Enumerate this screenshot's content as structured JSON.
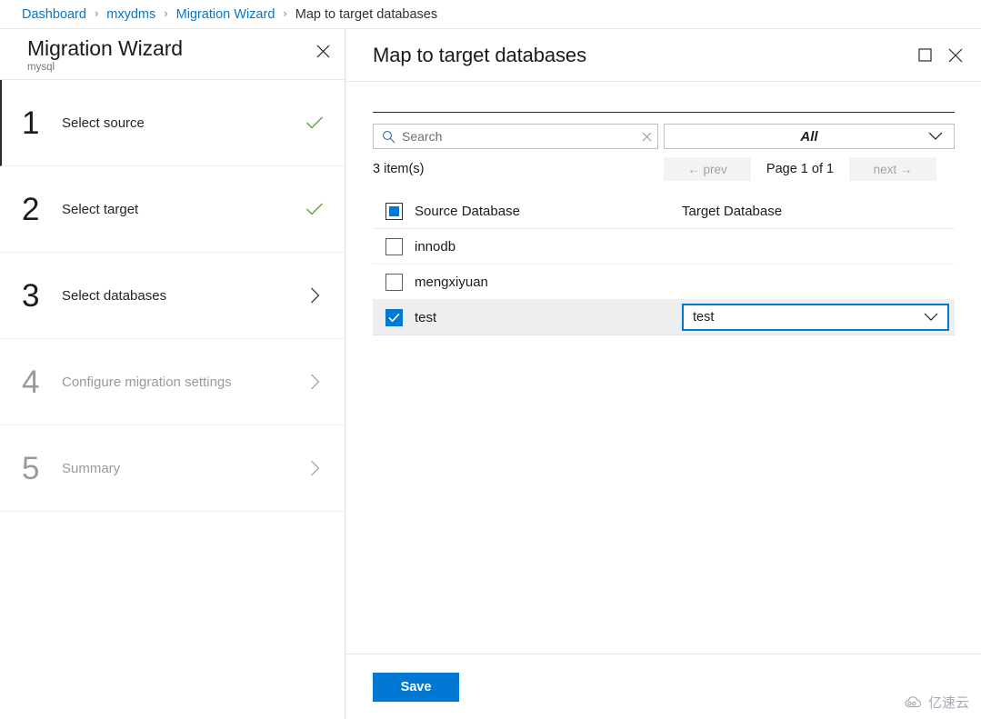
{
  "breadcrumb": {
    "items": [
      {
        "label": "Dashboard",
        "current": false
      },
      {
        "label": "mxydms",
        "current": false
      },
      {
        "label": "Migration Wizard",
        "current": false
      },
      {
        "label": "Map to target databases",
        "current": true
      }
    ],
    "separator": "›",
    "link_color": "#0078d4"
  },
  "wizard": {
    "title": "Migration Wizard",
    "subtitle": "mysql",
    "close_icon": "close-icon",
    "steps": [
      {
        "number": "1",
        "label": "Select source",
        "state": "complete",
        "icon": "check-icon"
      },
      {
        "number": "2",
        "label": "Select target",
        "state": "complete",
        "icon": "check-icon"
      },
      {
        "number": "3",
        "label": "Select databases",
        "state": "active",
        "icon": "chevron-right-icon"
      },
      {
        "number": "4",
        "label": "Configure migration settings",
        "state": "disabled",
        "icon": "chevron-right-icon"
      },
      {
        "number": "5",
        "label": "Summary",
        "state": "disabled",
        "icon": "chevron-right-icon"
      }
    ],
    "check_color": "#5cab3c"
  },
  "content": {
    "title": "Map to target databases",
    "maximize_icon": "maximize-icon",
    "close_icon": "close-icon",
    "search": {
      "value": "",
      "placeholder": "Search",
      "icon": "search-icon",
      "clear_icon": "clear-icon"
    },
    "filter": {
      "selected": "All",
      "options": [
        "All"
      ],
      "chevron_icon": "chevron-down-icon"
    },
    "item_count": "3 item(s)",
    "pagination": {
      "prev_label": "← prev",
      "next_label": "next →",
      "page_indicator": "Page 1 of 1",
      "prev_enabled": false,
      "next_enabled": false
    },
    "table": {
      "select_all_state": "indeterminate",
      "columns": [
        "Source Database",
        "Target Database"
      ],
      "rows": [
        {
          "source": "innodb",
          "checked": false,
          "target": ""
        },
        {
          "source": "mengxiyuan",
          "checked": false,
          "target": ""
        },
        {
          "source": "test",
          "checked": true,
          "target": "test"
        }
      ]
    },
    "save_label": "Save",
    "accent_color": "#0078d4"
  },
  "watermark": {
    "text": "亿速云"
  }
}
